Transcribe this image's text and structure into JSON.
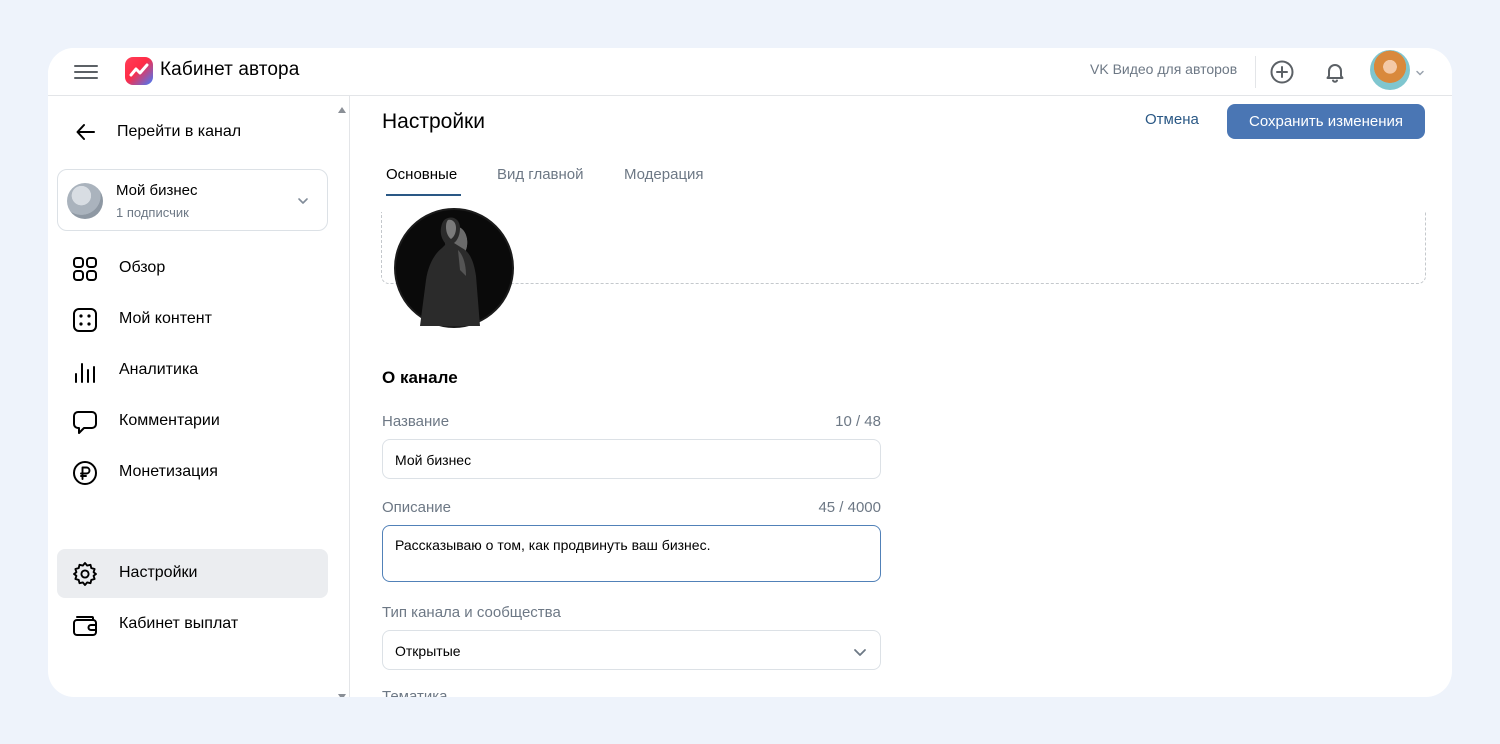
{
  "header": {
    "app_title": "Кабинет автора",
    "vk_link": "VK Видео для авторов",
    "icons": [
      "menu-icon",
      "add-icon",
      "bell-icon",
      "avatar"
    ]
  },
  "sidebar": {
    "back_label": "Перейти в канал",
    "channel": {
      "name": "Мой бизнес",
      "subscribers": "1 подписчик"
    },
    "items": [
      {
        "label": "Обзор",
        "icon": "grid-icon"
      },
      {
        "label": "Мой контент",
        "icon": "content-icon"
      },
      {
        "label": "Аналитика",
        "icon": "analytics-icon"
      },
      {
        "label": "Комментарии",
        "icon": "comment-icon"
      },
      {
        "label": "Монетизация",
        "icon": "ruble-icon"
      },
      {
        "label": "Настройки",
        "icon": "gear-icon",
        "active": true
      },
      {
        "label": "Кабинет выплат",
        "icon": "wallet-icon"
      }
    ]
  },
  "main": {
    "title": "Настройки",
    "cancel_label": "Отмена",
    "save_label": "Сохранить изменения",
    "tabs": [
      {
        "label": "Основные",
        "active": true
      },
      {
        "label": "Вид главной"
      },
      {
        "label": "Модерация"
      }
    ],
    "section_title": "О канале",
    "fields": {
      "name": {
        "label": "Название",
        "counter": "10 / 48",
        "value": "Мой бизнес"
      },
      "description": {
        "label": "Описание",
        "counter": "45 / 4000",
        "value": "Рассказываю о том, как продвинуть ваш бизнес."
      },
      "type": {
        "label": "Тип канала и сообщества",
        "value": "Открытые"
      },
      "topic": {
        "label": "Тематика"
      }
    }
  },
  "colors": {
    "accent": "#4a76b4",
    "link": "#2a5885",
    "muted_text": "#6d7885",
    "background": "#eef3fb"
  }
}
